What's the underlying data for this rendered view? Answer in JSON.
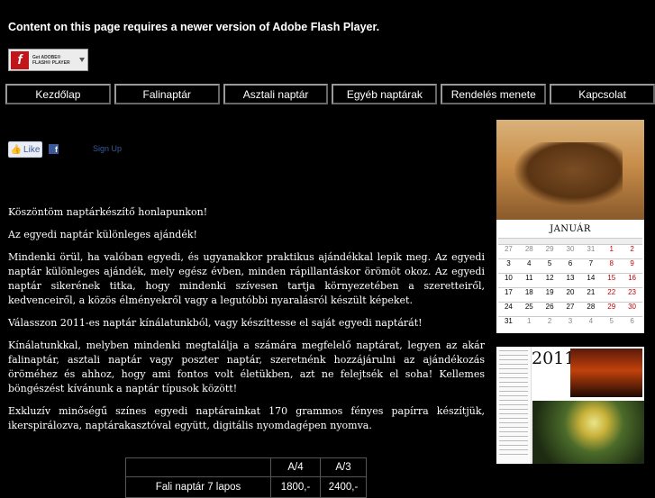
{
  "flash": {
    "message": "Content on this page requires a newer version of Adobe Flash Player.",
    "badge_line1": "Get ADOBE®",
    "badge_line2": "FLASH® PLAYER",
    "logo_letter": "f"
  },
  "nav": {
    "items": [
      "Kezdőlap",
      "Falinaptár",
      "Asztali naptár",
      "Egyéb naptárak",
      "Rendelés menete",
      "Kapcsolat"
    ]
  },
  "social": {
    "like": "Like",
    "fb": "f",
    "signup": "Sign Up"
  },
  "content": {
    "paragraphs": [
      "Köszöntöm naptárkészítő honlapunkon!",
      "Az egyedi naptár különleges ajándék!",
      "Mindenki örül, ha valóban egyedi, és ugyanakkor praktikus ajándékkal lepik meg. Az egyedi naptár különleges ajándék, mely egész évben, minden rápillantáskor örömöt okoz. Az egyedi naptár sikerének titka, hogy mindenki szívesen tartja környezetében a szeretteiről, kedvenceiről, a közös élményekről vagy a legutóbbi nyaralásról készült képeket.",
      "Válasszon 2011-es naptár kínálatunkból, vagy készíttesse el saját egyedi naptárát!",
      "Kínálatunkkal, melyben mindenki megtalálja a számára megfelelő naptárat, legyen az akár falinaptár, asztali naptár vagy poszter naptár, szeretnénk hozzájárulni az ajándékozás öröméhez és ahhoz, hogy ami fontos volt életükben, azt ne felejtsék el soha! Kellemes böngészést kívánunk a naptár típusok között!",
      "Exkluzív minőségű színes egyedi naptárainkat 170 grammos fényes papírra készítjük, ikerspirálozva, naptárakasztóval együtt, digitális nyomdagépen nyomva."
    ]
  },
  "prices": {
    "headers": [
      "",
      "A/4",
      "A/3"
    ],
    "rows": [
      {
        "name": "Fali naptár 7 lapos",
        "a4": "1800,-",
        "a3": "2400,-"
      }
    ]
  },
  "calendar1": {
    "month": "JANUÁR",
    "days": [
      "27",
      "28",
      "29",
      "30",
      "31",
      "1",
      "2",
      "3",
      "4",
      "5",
      "6",
      "7",
      "8",
      "9",
      "10",
      "11",
      "12",
      "13",
      "14",
      "15",
      "16",
      "17",
      "18",
      "19",
      "20",
      "21",
      "22",
      "23",
      "24",
      "25",
      "26",
      "27",
      "28",
      "29",
      "30",
      "31",
      "1",
      "2",
      "3",
      "4",
      "5",
      "6"
    ]
  },
  "calendar2": {
    "year": "2011"
  }
}
